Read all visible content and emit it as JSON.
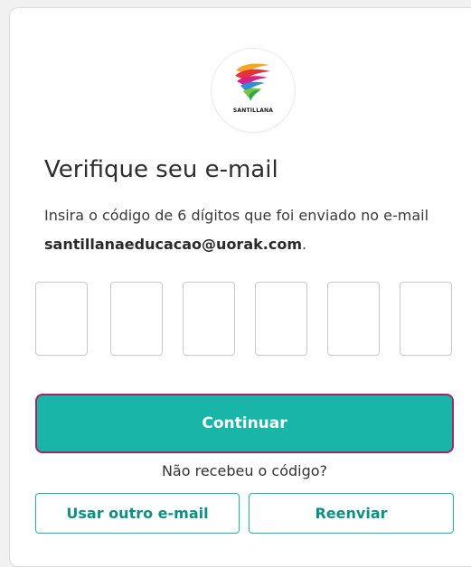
{
  "brand": {
    "name": "SANTILLANA",
    "logo_icon": "santillana-feather-logo",
    "accent_color": "#19b5a8",
    "focus_color": "#a0256b"
  },
  "verification": {
    "title": "Verifique seu e-mail",
    "description_prefix": "Insira o código de 6 dígitos que foi enviado no e-mail ",
    "email": "santillanaeducacao@uorak.com",
    "description_suffix": ".",
    "code_length": 6,
    "code_values": [
      "",
      "",
      "",
      "",
      "",
      ""
    ]
  },
  "actions": {
    "continue_label": "Continuar",
    "no_code_text": "Não recebeu o código?",
    "other_email_label": "Usar outro e-mail",
    "resend_label": "Reenviar"
  }
}
